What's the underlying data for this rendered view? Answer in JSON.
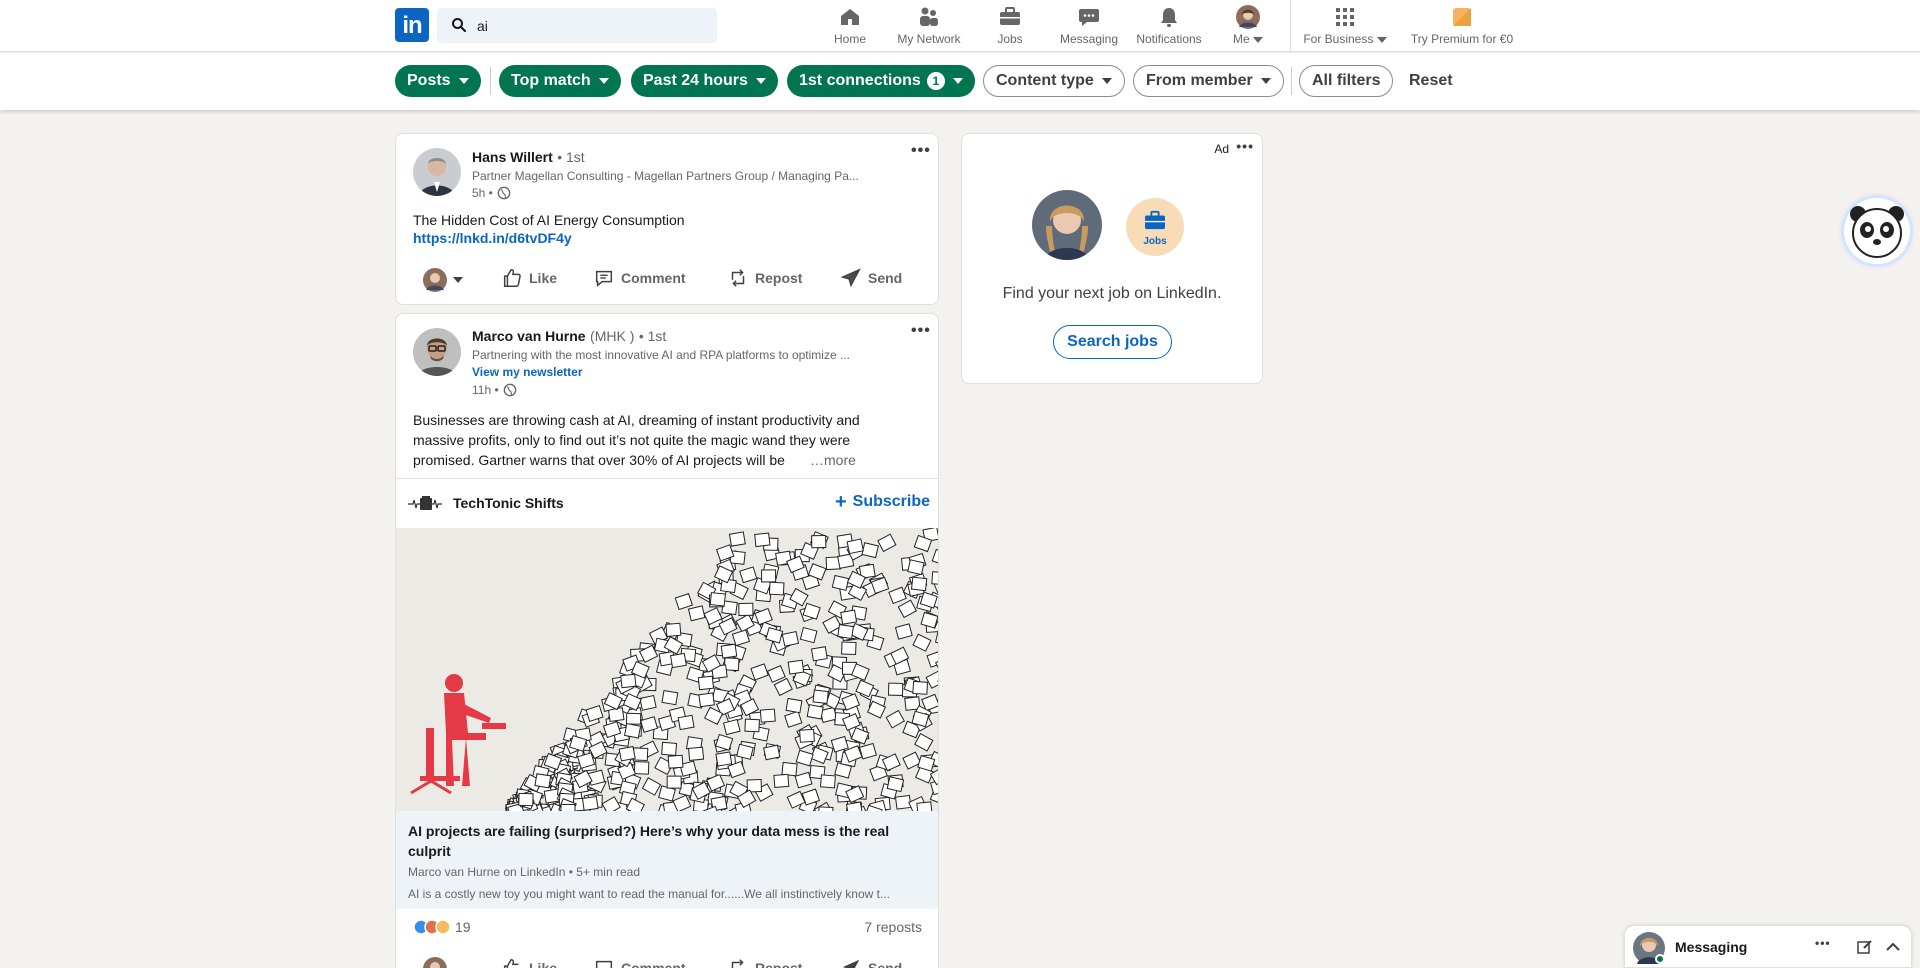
{
  "nav": {
    "logo_text": "in",
    "search_value": "ai",
    "items": [
      {
        "label": "Home",
        "icon": "home-icon"
      },
      {
        "label": "My Network",
        "icon": "network-icon"
      },
      {
        "label": "Jobs",
        "icon": "briefcase-icon"
      },
      {
        "label": "Messaging",
        "icon": "messaging-icon"
      },
      {
        "label": "Notifications",
        "icon": "bell-icon"
      },
      {
        "label": "Me",
        "icon": "avatar"
      }
    ],
    "for_business": "For Business",
    "premium": "Try Premium for €0"
  },
  "filters": {
    "posts": "Posts",
    "top_match": "Top match",
    "past_24": "Past 24 hours",
    "connections": "1st connections",
    "connections_count": "1",
    "content_type": "Content type",
    "from_member": "From member",
    "all_filters": "All filters",
    "reset": "Reset"
  },
  "post1": {
    "author": "Hans Willert",
    "degree": "• 1st",
    "headline": "Partner Magellan Consulting - Magellan Partners Group / Managing Pa...",
    "time": "5h •",
    "text": "The Hidden Cost of AI Energy Consumption",
    "link": "https://lnkd.in/d6tvDF4y"
  },
  "post2": {
    "author": "Marco van Hurne",
    "author_suffix": "(MHK )",
    "degree": "• 1st",
    "headline": "Partnering with the most innovative AI and RPA platforms to optimize ...",
    "newsletter_link": "View my newsletter",
    "time": "11h •",
    "text": "Businesses are throwing cash at AI, dreaming of instant productivity and massive profits, only to find out it’s not quite the magic wand they were promised. Gartner warns that over 30% of AI projects will be",
    "more": "…more",
    "newsletter_name": "TechTonic Shifts",
    "subscribe": "Subscribe",
    "article_title": "AI projects are failing (surprised?) Here’s why your data mess is the real culprit",
    "article_byline": "Marco van Hurne on LinkedIn • 5+ min read",
    "article_snippet": "AI is a costly new toy you might want to read the manual for......We all instinctively know t...",
    "reaction_count": "19",
    "reposts": "7 reposts"
  },
  "actions": {
    "like": "Like",
    "comment": "Comment",
    "repost": "Repost",
    "send": "Send"
  },
  "ad": {
    "label": "Ad",
    "jobs_badge": "Jobs",
    "text": "Find your next job on LinkedIn.",
    "button": "Search jobs"
  },
  "messaging": {
    "label": "Messaging"
  },
  "colors": {
    "brand": "#0a66c2",
    "filter_green": "#01754f",
    "background": "#f4f2ee"
  }
}
